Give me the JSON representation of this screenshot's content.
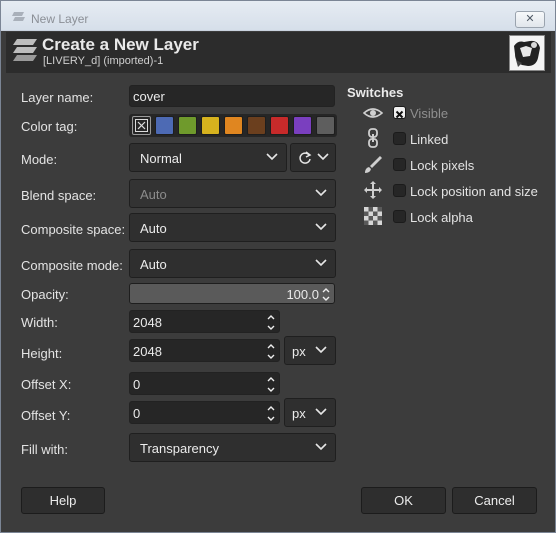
{
  "window": {
    "title": "New Layer",
    "close_glyph": "✕"
  },
  "header": {
    "title": "Create a New Layer",
    "subtitle": "[LIVERY_d] (imported)-1"
  },
  "form": {
    "layer_name": {
      "label": "Layer name:",
      "value": "cover"
    },
    "color_tag": {
      "label": "Color tag:",
      "tags": [
        {
          "name": "none",
          "color": "#262626"
        },
        {
          "name": "blue",
          "color": "#4d6ab4"
        },
        {
          "name": "green",
          "color": "#6f9a2c"
        },
        {
          "name": "yellow",
          "color": "#d6b21e"
        },
        {
          "name": "orange",
          "color": "#e08620"
        },
        {
          "name": "brown",
          "color": "#6b3f1e"
        },
        {
          "name": "red",
          "color": "#c72a2a"
        },
        {
          "name": "violet",
          "color": "#7a3fbf"
        },
        {
          "name": "gray",
          "color": "#5e5e5e"
        }
      ]
    },
    "mode": {
      "label": "Mode:",
      "value": "Normal"
    },
    "blend_space": {
      "label": "Blend space:",
      "value": "Auto"
    },
    "composite_space": {
      "label": "Composite space:",
      "value": "Auto"
    },
    "composite_mode": {
      "label": "Composite mode:",
      "value": "Auto"
    },
    "opacity": {
      "label": "Opacity:",
      "value": "100.0"
    },
    "width": {
      "label": "Width:",
      "value": "2048"
    },
    "height": {
      "label": "Height:",
      "value": "2048",
      "unit": "px"
    },
    "offset_x": {
      "label": "Offset X:",
      "value": "0"
    },
    "offset_y": {
      "label": "Offset Y:",
      "value": "0",
      "unit": "px"
    },
    "fill_with": {
      "label": "Fill with:",
      "value": "Transparency"
    }
  },
  "switches": {
    "title": "Switches",
    "items": [
      {
        "label": "Visible",
        "checked": true,
        "icon": "eye-icon"
      },
      {
        "label": "Linked",
        "checked": false,
        "icon": "chain-icon"
      },
      {
        "label": "Lock pixels",
        "checked": false,
        "icon": "brush-icon"
      },
      {
        "label": "Lock position and size",
        "checked": false,
        "icon": "move-icon"
      },
      {
        "label": "Lock alpha",
        "checked": false,
        "icon": "checkerboard-icon"
      }
    ]
  },
  "buttons": {
    "help": "Help",
    "ok": "OK",
    "cancel": "Cancel"
  }
}
